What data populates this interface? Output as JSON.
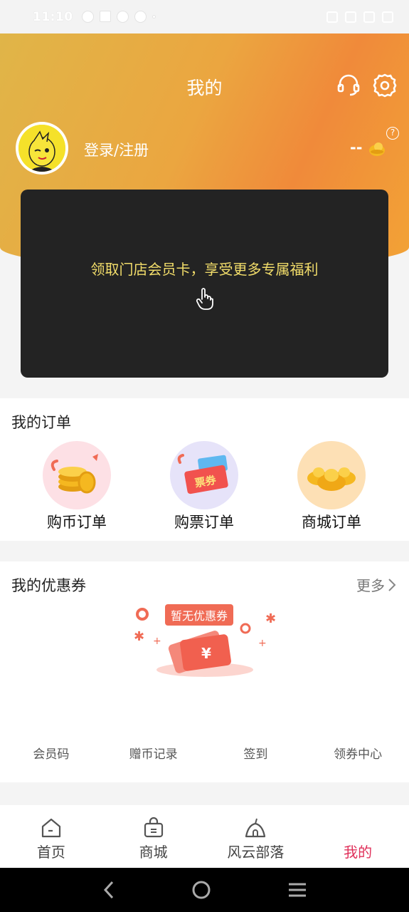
{
  "status_bar": {
    "time": "11:10"
  },
  "header": {
    "title": "我的",
    "login_label": "登录/注册",
    "coin_value": "--",
    "help_glyph": "?"
  },
  "member_card": {
    "text": "领取门店会员卡，享受更多专属福利"
  },
  "orders": {
    "title": "我的订单",
    "items": [
      {
        "label": "购币订单",
        "icon": "coin-stack-icon"
      },
      {
        "label": "购票订单",
        "icon": "ticket-icon",
        "badge": "票券"
      },
      {
        "label": "商城订单",
        "icon": "gold-ingot-icon"
      }
    ]
  },
  "coupons": {
    "title": "我的优惠券",
    "more_label": "更多",
    "empty_label": "暂无优惠券",
    "coupon_symbol": "¥"
  },
  "quick_links": [
    "会员码",
    "赠币记录",
    "签到",
    "领券中心"
  ],
  "tabs": [
    {
      "label": "首页",
      "icon": "home-icon"
    },
    {
      "label": "商城",
      "icon": "shopping-bag-icon"
    },
    {
      "label": "风云部落",
      "icon": "tent-icon"
    },
    {
      "label": "我的",
      "icon": "profile-icon",
      "active": true
    }
  ],
  "colors": {
    "accent": "#e0305a",
    "header_start": "#e0b548",
    "header_end": "#f08a3a",
    "card_text": "#f2dd6a"
  }
}
